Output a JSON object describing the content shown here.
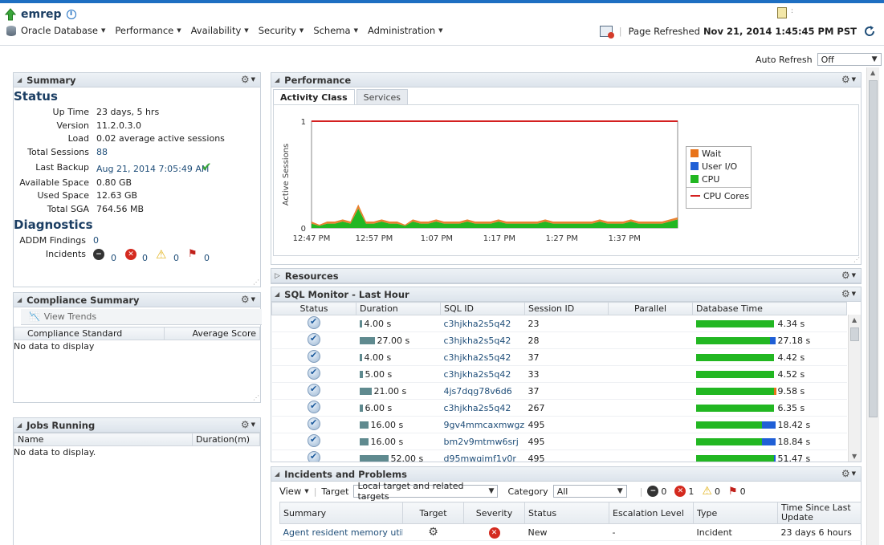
{
  "header": {
    "target_name": "emrep",
    "menus": [
      {
        "label": "Oracle Database"
      },
      {
        "label": "Performance"
      },
      {
        "label": "Availability"
      },
      {
        "label": "Security"
      },
      {
        "label": "Schema"
      },
      {
        "label": "Administration"
      }
    ],
    "page_refreshed_label": "Page Refreshed",
    "page_refreshed_value": "Nov 21, 2014 1:45:45 PM PST",
    "auto_refresh_label": "Auto Refresh",
    "auto_refresh_value": "Off"
  },
  "summary": {
    "title": "Summary",
    "status_heading": "Status",
    "rows": [
      {
        "label": "Up Time",
        "value": "23 days, 5 hrs"
      },
      {
        "label": "Version",
        "value": "11.2.0.3.0"
      },
      {
        "label": "Load",
        "value": "0.02 average active sessions"
      },
      {
        "label": "Total Sessions",
        "value": "88"
      },
      {
        "label": "Last Backup",
        "value": "Aug 21, 2014 7:05:49 AM"
      },
      {
        "label": "Available Space",
        "value": "0.80 GB"
      },
      {
        "label": "Used Space",
        "value": "12.63 GB"
      },
      {
        "label": "Total SGA",
        "value": "764.56 MB"
      }
    ],
    "diagnostics_heading": "Diagnostics",
    "addm_label": "ADDM Findings",
    "addm_value": "0",
    "incidents_label": "Incidents",
    "incident_counts": [
      "0",
      "0",
      "0",
      "0"
    ]
  },
  "compliance": {
    "title": "Compliance Summary",
    "view_trends": "View Trends",
    "col_standard": "Compliance Standard",
    "col_score": "Average Score",
    "empty": "No data to display"
  },
  "jobs": {
    "title": "Jobs Running",
    "col_name": "Name",
    "col_duration": "Duration(m)",
    "empty": "No data to display."
  },
  "performance": {
    "title": "Performance",
    "tabs": [
      "Activity Class",
      "Services"
    ],
    "legend": [
      "Wait",
      "User I/O",
      "CPU",
      "CPU Cores"
    ]
  },
  "colors": {
    "wait": "#e8731a",
    "user_io": "#1f5fd6",
    "cpu": "#22b722",
    "cpu_cores": "#d42020",
    "accent": "#1e6fc2"
  },
  "chart_data": {
    "type": "area",
    "ylabel": "Active Sessions",
    "ylim": [
      0,
      1
    ],
    "yticks": [
      "1",
      "0"
    ],
    "x_ticks": [
      "12:47 PM",
      "12:57 PM",
      "1:07 PM",
      "1:17 PM",
      "1:27 PM",
      "1:37 PM"
    ],
    "cpu_cores": 1,
    "series": [
      {
        "name": "CPU",
        "values": [
          0.02,
          0.01,
          0.02,
          0.02,
          0.03,
          0.02,
          0.09,
          0.02,
          0.02,
          0.03,
          0.02,
          0.02,
          0.01,
          0.03,
          0.02,
          0.02,
          0.03,
          0.02,
          0.02,
          0.02,
          0.03,
          0.02,
          0.02,
          0.02,
          0.03,
          0.02,
          0.02,
          0.02,
          0.02,
          0.02,
          0.03,
          0.02,
          0.02,
          0.02,
          0.02,
          0.02,
          0.02,
          0.03,
          0.02,
          0.02,
          0.02,
          0.03,
          0.02,
          0.02,
          0.02,
          0.02,
          0.03,
          0.04
        ]
      },
      {
        "name": "Wait",
        "values": [
          0.01,
          0.005,
          0.01,
          0.01,
          0.01,
          0.01,
          0.02,
          0.01,
          0.01,
          0.01,
          0.01,
          0.01,
          0.005,
          0.01,
          0.01,
          0.01,
          0.01,
          0.01,
          0.01,
          0.01,
          0.01,
          0.01,
          0.01,
          0.01,
          0.01,
          0.01,
          0.01,
          0.01,
          0.01,
          0.01,
          0.01,
          0.01,
          0.01,
          0.01,
          0.01,
          0.01,
          0.01,
          0.01,
          0.01,
          0.01,
          0.01,
          0.01,
          0.01,
          0.01,
          0.01,
          0.01,
          0.01,
          0.01
        ]
      }
    ]
  },
  "resources": {
    "title": "Resources"
  },
  "sql_monitor": {
    "title": "SQL Monitor - Last Hour",
    "columns": [
      "Status",
      "Duration",
      "SQL ID",
      "Session ID",
      "Parallel",
      "Database Time"
    ],
    "rows": [
      {
        "duration": "4.00 s",
        "dur_s": 4,
        "sql_id": "c3hjkha2s5q42",
        "session": "23",
        "parallel": "",
        "db_time": "4.34 s",
        "db_frac": 0.97,
        "io_frac": 0.0,
        "wait_frac": 0.0
      },
      {
        "duration": "27.00 s",
        "dur_s": 27,
        "sql_id": "c3hjkha2s5q42",
        "session": "28",
        "parallel": "",
        "db_time": "27.18 s",
        "db_frac": 0.92,
        "io_frac": 0.07,
        "wait_frac": 0.0
      },
      {
        "duration": "4.00 s",
        "dur_s": 4,
        "sql_id": "c3hjkha2s5q42",
        "session": "37",
        "parallel": "",
        "db_time": "4.42 s",
        "db_frac": 0.97,
        "io_frac": 0.0,
        "wait_frac": 0.0
      },
      {
        "duration": "5.00 s",
        "dur_s": 5,
        "sql_id": "c3hjkha2s5q42",
        "session": "33",
        "parallel": "",
        "db_time": "4.52 s",
        "db_frac": 0.97,
        "io_frac": 0.0,
        "wait_frac": 0.0
      },
      {
        "duration": "21.00 s",
        "dur_s": 21,
        "sql_id": "4js7dqg78v6d6",
        "session": "37",
        "parallel": "",
        "db_time": "9.58 s",
        "db_frac": 0.97,
        "io_frac": 0.0,
        "wait_frac": 0.03
      },
      {
        "duration": "6.00 s",
        "dur_s": 6,
        "sql_id": "c3hjkha2s5q42",
        "session": "267",
        "parallel": "",
        "db_time": "6.35 s",
        "db_frac": 0.97,
        "io_frac": 0.0,
        "wait_frac": 0.0
      },
      {
        "duration": "16.00 s",
        "dur_s": 16,
        "sql_id": "9gv4mmcaxmwgz",
        "session": "495",
        "parallel": "",
        "db_time": "18.42 s",
        "db_frac": 0.82,
        "io_frac": 0.17,
        "wait_frac": 0.0
      },
      {
        "duration": "16.00 s",
        "dur_s": 16,
        "sql_id": "bm2v9mtmw6srj",
        "session": "495",
        "parallel": "",
        "db_time": "18.84 s",
        "db_frac": 0.82,
        "io_frac": 0.17,
        "wait_frac": 0.0
      },
      {
        "duration": "52.00 s",
        "dur_s": 52,
        "sql_id": "d95mwgimf1v0r",
        "session": "495",
        "parallel": "",
        "db_time": "51.47 s",
        "db_frac": 0.97,
        "io_frac": 0.02,
        "wait_frac": 0.0
      }
    ]
  },
  "incidents": {
    "title": "Incidents and Problems",
    "view_label": "View",
    "target_label": "Target",
    "target_value": "Local target and related targets",
    "category_label": "Category",
    "category_value": "All",
    "counts": [
      "0",
      "1",
      "0",
      "0"
    ],
    "columns": [
      "Summary",
      "Target",
      "Severity",
      "Status",
      "Escalation Level",
      "Type",
      "Time Since Last Update"
    ],
    "rows": [
      {
        "summary": "Agent resident memory utili...",
        "status": "New",
        "escalation": "-",
        "type": "Incident",
        "time": "23 days 6 hours"
      }
    ]
  }
}
